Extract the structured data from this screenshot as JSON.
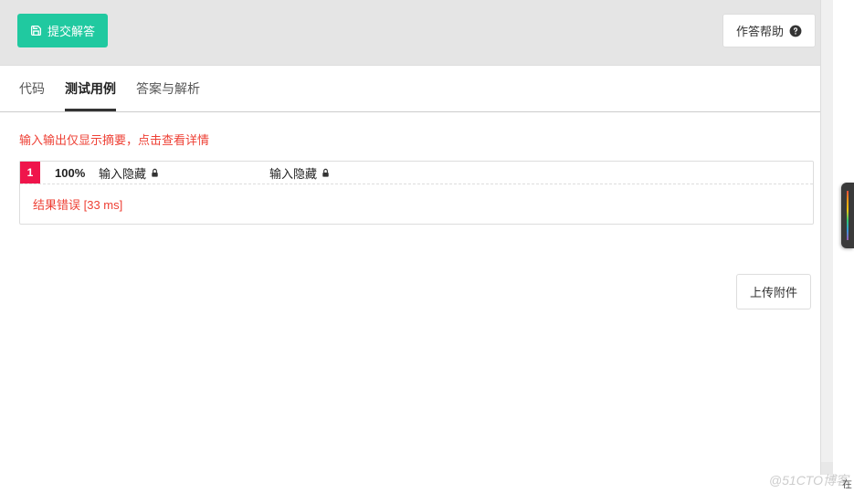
{
  "header": {
    "submit_label": "提交解答",
    "help_label": "作答帮助"
  },
  "tabs": {
    "code": "代码",
    "testcases": "测试用例",
    "solution": "答案与解析",
    "active": "testcases"
  },
  "testcase_panel": {
    "hint": "输入输出仅显示摘要，点击查看详情",
    "cases": [
      {
        "index": "1",
        "score": "100%",
        "input_label": "输入隐藏",
        "output_label": "输入隐藏",
        "result": "结果错误 [33 ms]"
      }
    ]
  },
  "upload": {
    "label": "上传附件"
  },
  "watermark": "@51CTO博客",
  "watermark_sub": "在"
}
